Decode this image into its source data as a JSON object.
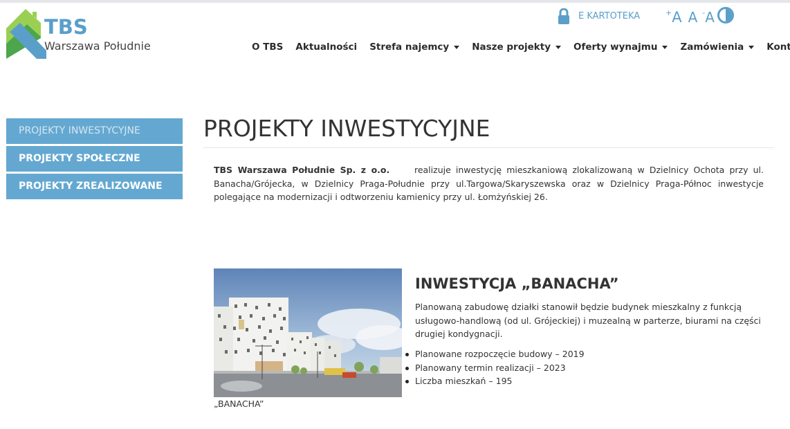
{
  "brand": {
    "name": "TBS",
    "subtitle": "Warszawa Południe",
    "colors": {
      "accent": "#5a9fca",
      "green_light": "#9bcf54",
      "green_dark": "#4da64b",
      "blue": "#5a9fca"
    }
  },
  "utility": {
    "kartoteka_icon": "lock-icon",
    "kartoteka_label": "E KARTOTEKA",
    "font_increase": "A",
    "font_increase_sign": "+",
    "font_normal": "A",
    "font_decrease": "A",
    "font_decrease_sign": "-",
    "contrast_icon": "contrast-icon"
  },
  "nav": {
    "items": [
      {
        "label": "O TBS",
        "dropdown": false
      },
      {
        "label": "Aktualności",
        "dropdown": false
      },
      {
        "label": "Strefa najemcy",
        "dropdown": true
      },
      {
        "label": "Nasze projekty",
        "dropdown": true
      },
      {
        "label": "Oferty wynajmu",
        "dropdown": true
      },
      {
        "label": "Zamówienia",
        "dropdown": true
      },
      {
        "label": "Kontakt",
        "dropdown": false
      }
    ]
  },
  "sidebar": {
    "items": [
      {
        "label": "PROJEKTY INWESTYCYJNE",
        "active": true
      },
      {
        "label": "PROJEKTY SPOŁECZNE",
        "active": false
      },
      {
        "label": "PROJEKTY ZREALIZOWANE",
        "active": false
      }
    ]
  },
  "main": {
    "title": "PROJEKTY INWESTYCYJNE",
    "intro_company": "TBS Warszawa Południe Sp. z o.o.",
    "intro_text": "realizuje inwestycję mieszkaniową zlokalizowaną w Dzielnicy Ochota przy ul. Banacha/Grójecka, w Dzielnicy Praga-Południe przy ul.Targowa/Skaryszewska oraz w Dzielnicy Praga-Północ inwestycje polegające na modernizacji i odtworzeniu kamienicy przy ul. Łomżyńskiej 26.",
    "investment": {
      "title": "INWESTYCJA „BANACHA”",
      "description": "Planowaną zabudowę działki stanowił będzie budynek mieszkalny z funkcją usługowo-handlową (od ul. Grójeckiej) i muzealną w parterze, biurami na części drugiej kondygnacji.",
      "facts": [
        "Planowane rozpoczęcie budowy – 2019",
        "Planowany termin realizacji – 2023",
        "Liczba mieszkań – 195"
      ],
      "image_caption": "„BANACHA”"
    }
  }
}
